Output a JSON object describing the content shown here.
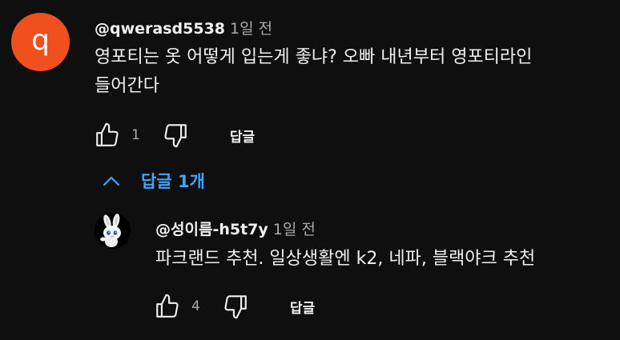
{
  "comment": {
    "avatar_letter": "q",
    "avatar_color": "#f0501e",
    "author": "@qwerasd5538",
    "time": "1일 전",
    "text_line1": "영포티는 옷 어떻게 입는게 좋냐? 오빠 내년부터 영포티라인",
    "text_line2": "들어간다",
    "like_count": "1",
    "reply_label": "답글"
  },
  "replies_toggle": {
    "label": "답글 1개",
    "accent": "#3ea6ff"
  },
  "reply": {
    "author": "@성이름-h5t7y",
    "time": "1일 전",
    "text": "파크랜드 추천. 일상생활엔 k2, 네파, 블랙야크 추천",
    "like_count": "4",
    "reply_label": "답글"
  }
}
